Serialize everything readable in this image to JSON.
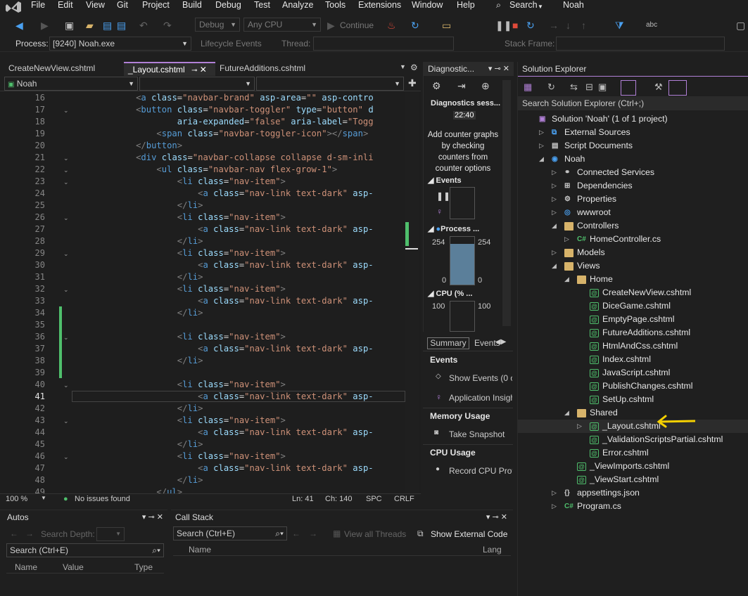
{
  "menu": [
    "File",
    "Edit",
    "View",
    "Git",
    "Project",
    "Build",
    "Debug",
    "Test",
    "Analyze",
    "Tools",
    "Extensions",
    "Window",
    "Help"
  ],
  "search_label": "Search",
  "solution_name": "Noah",
  "toolbar": {
    "config": "Debug",
    "platform": "Any CPU",
    "continue": "Continue"
  },
  "process": {
    "label": "Process:",
    "value": "[9240] Noah.exe",
    "lifecycle": "Lifecycle Events",
    "thread": "Thread:",
    "stackframe": "Stack Frame:"
  },
  "tabs": [
    "CreateNewView.cshtml",
    "_Layout.cshtml",
    "FutureAdditions.cshtml"
  ],
  "editor": {
    "project_combo": "Noah",
    "lines": [
      16,
      17,
      18,
      19,
      20,
      21,
      22,
      23,
      24,
      25,
      26,
      27,
      28,
      29,
      30,
      31,
      32,
      33,
      34,
      35,
      36,
      37,
      38,
      39,
      40,
      41,
      42,
      43,
      44,
      45,
      46,
      47,
      48,
      49
    ],
    "current_line": 41,
    "status": {
      "zoom": "100 %",
      "issues": "No issues found",
      "ln": "Ln: 41",
      "ch": "Ch: 140",
      "spc": "SPC",
      "crlf": "CRLF"
    }
  },
  "diagnostics": {
    "title": "Diagnostic...",
    "session": "Diagnostics sess...",
    "time": "22:40",
    "hint": "Add counter graphs by checking counters from counter options",
    "events": "Events",
    "process_mem": "Process ...",
    "mem_val": "254",
    "mem_zero": "0",
    "cpu": "CPU (% ...",
    "cpu_val": "100",
    "tab_summary": "Summary",
    "tab_events": "Events",
    "sections": {
      "events": "Events",
      "show_events": "Show Events (0 of",
      "app_insights": "Application Insigh",
      "memory": "Memory Usage",
      "snapshot": "Take Snapshot",
      "cpu": "CPU Usage",
      "record": "Record CPU Profile"
    },
    "mem_level": 0.85
  },
  "solution_explorer": {
    "title": "Solution Explorer",
    "search": "Search Solution Explorer (Ctrl+;)",
    "items": [
      {
        "label": "Solution 'Noah' (1 of 1 project)",
        "depth": 0,
        "expand": "",
        "icon": "solution-icon"
      },
      {
        "label": "External Sources",
        "depth": 1,
        "expand": "closed",
        "icon": "external-sources-icon"
      },
      {
        "label": "Script Documents",
        "depth": 1,
        "expand": "closed",
        "icon": "script-documents-icon"
      },
      {
        "label": "Noah",
        "depth": 1,
        "expand": "open",
        "icon": "web-project-icon"
      },
      {
        "label": "Connected Services",
        "depth": 2,
        "expand": "closed",
        "icon": "connected-services-icon"
      },
      {
        "label": "Dependencies",
        "depth": 2,
        "expand": "closed",
        "icon": "dependencies-icon"
      },
      {
        "label": "Properties",
        "depth": 2,
        "expand": "closed",
        "icon": "properties-icon"
      },
      {
        "label": "wwwroot",
        "depth": 2,
        "expand": "closed",
        "icon": "globe-icon"
      },
      {
        "label": "Controllers",
        "depth": 2,
        "expand": "open",
        "icon": "folder-icon"
      },
      {
        "label": "HomeController.cs",
        "depth": 3,
        "expand": "closed",
        "icon": "csharp-file-icon"
      },
      {
        "label": "Models",
        "depth": 2,
        "expand": "closed",
        "icon": "folder-icon"
      },
      {
        "label": "Views",
        "depth": 2,
        "expand": "open",
        "icon": "folder-icon"
      },
      {
        "label": "Home",
        "depth": 3,
        "expand": "open",
        "icon": "folder-icon"
      },
      {
        "label": "CreateNewView.cshtml",
        "depth": 4,
        "expand": "",
        "icon": "razor-file-icon"
      },
      {
        "label": "DiceGame.cshtml",
        "depth": 4,
        "expand": "",
        "icon": "razor-file-icon"
      },
      {
        "label": "EmptyPage.cshtml",
        "depth": 4,
        "expand": "",
        "icon": "razor-file-icon"
      },
      {
        "label": "FutureAdditions.cshtml",
        "depth": 4,
        "expand": "",
        "icon": "razor-file-icon"
      },
      {
        "label": "HtmlAndCss.cshtml",
        "depth": 4,
        "expand": "",
        "icon": "razor-file-icon"
      },
      {
        "label": "Index.cshtml",
        "depth": 4,
        "expand": "",
        "icon": "razor-file-icon"
      },
      {
        "label": "JavaScript.cshtml",
        "depth": 4,
        "expand": "",
        "icon": "razor-file-icon"
      },
      {
        "label": "PublishChanges.cshtml",
        "depth": 4,
        "expand": "",
        "icon": "razor-file-icon"
      },
      {
        "label": "SetUp.cshtml",
        "depth": 4,
        "expand": "",
        "icon": "razor-file-icon"
      },
      {
        "label": "Shared",
        "depth": 3,
        "expand": "open",
        "icon": "folder-icon"
      },
      {
        "label": "_Layout.cshtml",
        "depth": 4,
        "expand": "closed",
        "icon": "razor-file-icon",
        "selected": true
      },
      {
        "label": "_ValidationScriptsPartial.cshtml",
        "depth": 4,
        "expand": "",
        "icon": "razor-file-icon"
      },
      {
        "label": "Error.cshtml",
        "depth": 4,
        "expand": "",
        "icon": "razor-file-icon"
      },
      {
        "label": "_ViewImports.cshtml",
        "depth": 3,
        "expand": "",
        "icon": "razor-file-icon"
      },
      {
        "label": "_ViewStart.cshtml",
        "depth": 3,
        "expand": "",
        "icon": "razor-file-icon"
      },
      {
        "label": "appsettings.json",
        "depth": 2,
        "expand": "closed",
        "icon": "json-file-icon"
      },
      {
        "label": "Program.cs",
        "depth": 2,
        "expand": "closed",
        "icon": "csharp-file-icon"
      }
    ]
  },
  "autos": {
    "title": "Autos",
    "search": "Search (Ctrl+E)",
    "search_depth": "Search Depth:",
    "cols": [
      "Name",
      "Value",
      "Type"
    ]
  },
  "callstack": {
    "title": "Call Stack",
    "search": "Search (Ctrl+E)",
    "view_all": "View all Threads",
    "show_external": "Show External Code",
    "cols": [
      "Name",
      "Lang"
    ]
  },
  "colors": {
    "accent": "#b180d7",
    "arrow": "#f5d000",
    "green": "#4fbf6c"
  }
}
